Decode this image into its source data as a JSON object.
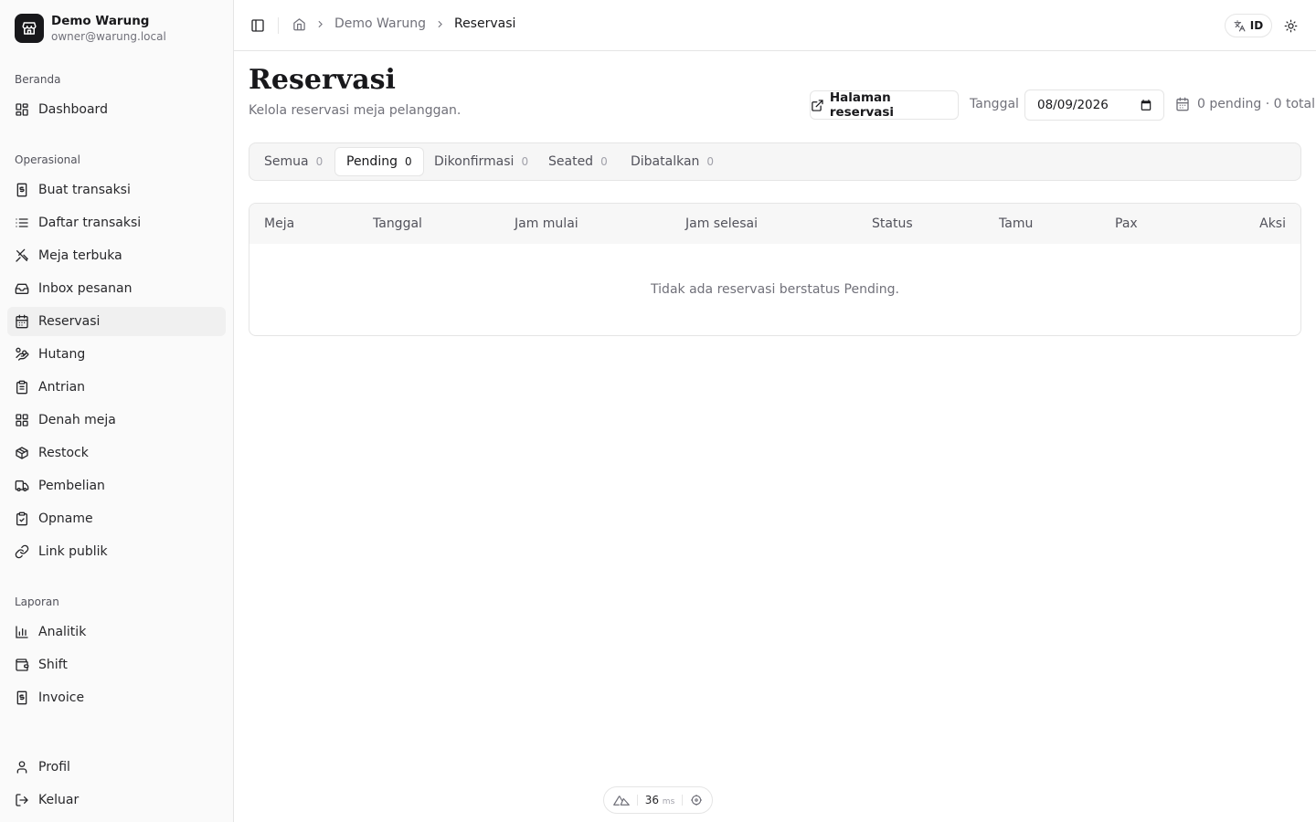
{
  "brand": {
    "name": "Demo Warung",
    "email": "owner@warung.local"
  },
  "sidebar": {
    "sections": [
      {
        "label": "Beranda",
        "items": [
          {
            "label": "Dashboard",
            "icon": "dashboard-icon"
          }
        ]
      },
      {
        "label": "Operasional",
        "items": [
          {
            "label": "Buat transaksi",
            "icon": "receipt-icon"
          },
          {
            "label": "Daftar transaksi",
            "icon": "list-icon"
          },
          {
            "label": "Meja terbuka",
            "icon": "utensils-icon"
          },
          {
            "label": "Inbox pesanan",
            "icon": "inbox-icon"
          },
          {
            "label": "Reservasi",
            "icon": "calendar-icon",
            "active": true
          },
          {
            "label": "Hutang",
            "icon": "hand-coins-icon"
          },
          {
            "label": "Antrian",
            "icon": "clipboard-icon"
          },
          {
            "label": "Denah meja",
            "icon": "grid-icon"
          },
          {
            "label": "Restock",
            "icon": "package-icon"
          },
          {
            "label": "Pembelian",
            "icon": "truck-icon"
          },
          {
            "label": "Opname",
            "icon": "clipboard-check-icon"
          },
          {
            "label": "Link publik",
            "icon": "link-icon"
          }
        ]
      },
      {
        "label": "Laporan",
        "items": [
          {
            "label": "Analitik",
            "icon": "bar-chart-icon"
          },
          {
            "label": "Shift",
            "icon": "wallet-icon"
          },
          {
            "label": "Invoice",
            "icon": "invoice-icon"
          }
        ]
      }
    ],
    "footer": [
      {
        "label": "Profil",
        "icon": "user-icon"
      },
      {
        "label": "Keluar",
        "icon": "logout-icon"
      }
    ]
  },
  "header": {
    "breadcrumb": {
      "store": "Demo Warung",
      "current": "Reservasi"
    },
    "language": "ID"
  },
  "main": {
    "title": "Reservasi",
    "subtitle": "Kelola reservasi meja pelanggan.",
    "external_button": "Halaman reservasi",
    "date_label": "Tanggal",
    "date_value": "08/09/2026",
    "summary": "0 pending · 0 total",
    "tabs": [
      {
        "label": "Semua",
        "count": "0"
      },
      {
        "label": "Pending",
        "count": "0",
        "active": true
      },
      {
        "label": "Dikonfirmasi",
        "count": "0"
      },
      {
        "label": "Seated",
        "count": "0"
      },
      {
        "label": "Dibatalkan",
        "count": "0"
      }
    ],
    "table": {
      "columns": [
        "Meja",
        "Tanggal",
        "Jam mulai",
        "Jam selesai",
        "Status",
        "Tamu",
        "Pax",
        "Aksi"
      ],
      "empty_message": "Tidak ada reservasi berstatus Pending."
    }
  },
  "devbar": {
    "value": "36",
    "unit": "ms"
  },
  "colors": {
    "text": "#18181b",
    "muted": "#71717a",
    "border": "#e5e5e5",
    "sidebar_bg": "#fafafa"
  }
}
